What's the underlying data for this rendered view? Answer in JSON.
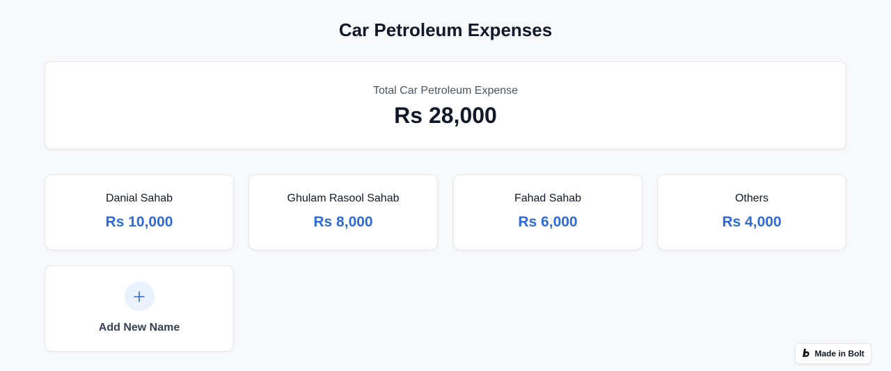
{
  "page": {
    "title": "Car Petroleum Expenses"
  },
  "summary": {
    "label": "Total Car Petroleum Expense",
    "value": "Rs 28,000"
  },
  "people": [
    {
      "name": "Danial Sahab",
      "amount": "Rs 10,000"
    },
    {
      "name": "Ghulam Rasool Sahab",
      "amount": "Rs 8,000"
    },
    {
      "name": "Fahad Sahab",
      "amount": "Rs 6,000"
    },
    {
      "name": "Others",
      "amount": "Rs 4,000"
    }
  ],
  "add_card": {
    "icon": "plus-icon",
    "label": "Add New Name"
  },
  "badge": {
    "icon": "bolt-logo-icon",
    "label": "Made in Bolt"
  },
  "colors": {
    "accent": "#2f6bd8",
    "background": "#f8f9fb",
    "add_circle": "#eaf2fd"
  }
}
